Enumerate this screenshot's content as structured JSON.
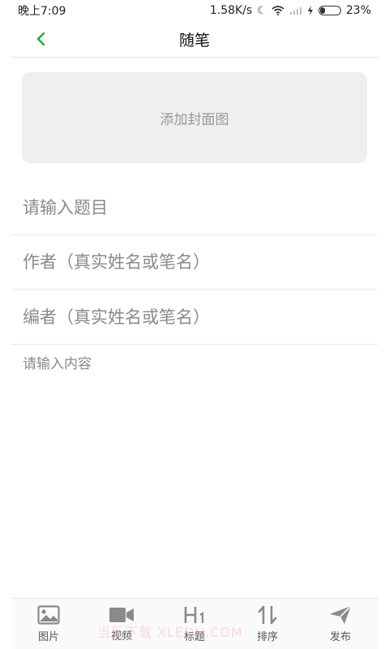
{
  "status_bar": {
    "time": "晚上7:09",
    "network_speed": "1.58K/s",
    "battery_percent": "23%",
    "battery_level": 0.23,
    "icons": [
      "moon-icon",
      "wifi-icon",
      "signal-icon",
      "charging-icon",
      "battery-icon"
    ]
  },
  "header": {
    "title": "随笔",
    "back_icon": "chevron-left-icon",
    "accent_color": "#2aa52a"
  },
  "cover": {
    "label": "添加封面图"
  },
  "form": {
    "title_placeholder": "请输入题目",
    "author_placeholder": "作者（真实姓名或笔名）",
    "editor_placeholder": "编者（真实姓名或笔名）",
    "content_placeholder": "请输入内容"
  },
  "toolbar": {
    "items": [
      {
        "label": "图片",
        "icon": "image-icon"
      },
      {
        "label": "视频",
        "icon": "video-icon"
      },
      {
        "label": "标题",
        "icon": "heading-icon"
      },
      {
        "label": "排序",
        "icon": "sort-icon"
      },
      {
        "label": "发布",
        "icon": "send-icon"
      }
    ]
  },
  "watermark": {
    "text": "当乐下载 XLEDU.COM"
  }
}
